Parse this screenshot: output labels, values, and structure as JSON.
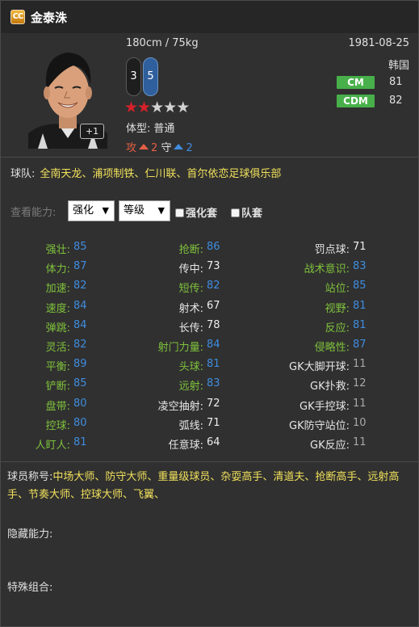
{
  "header": {
    "name": "金泰洙",
    "badge_text": "CC"
  },
  "player": {
    "height_weight": "180cm / 75kg",
    "birthdate": "1981-08-25",
    "nation": "韩国",
    "weak_foot_left": "3",
    "weak_foot_right": "5",
    "stars_total": 5,
    "stars_filled": 2,
    "body_label": "体型:",
    "body_value": "普通",
    "attack_label": "攻",
    "attack_value": "2",
    "defense_label": "守",
    "defense_value": "2",
    "plus_badge": "+1",
    "positions": [
      {
        "name": "CM",
        "rating": "81"
      },
      {
        "name": "CDM",
        "rating": "82"
      }
    ]
  },
  "team": {
    "label": "球队:",
    "value": "全南天龙、浦项制铁、仁川联、首尔依恋足球俱乐部"
  },
  "view": {
    "label": "查看能力:",
    "select1": "强化",
    "select2": "等级",
    "check1": "强化套",
    "check2": "队套"
  },
  "stats": {
    "col1": [
      {
        "label": "强壮:",
        "value": "85"
      },
      {
        "label": "体力:",
        "value": "87"
      },
      {
        "label": "加速:",
        "value": "82"
      },
      {
        "label": "速度:",
        "value": "84"
      },
      {
        "label": "弹跳:",
        "value": "84"
      },
      {
        "label": "灵活:",
        "value": "82"
      },
      {
        "label": "平衡:",
        "value": "89"
      },
      {
        "label": "铲断:",
        "value": "85"
      },
      {
        "label": "盘带:",
        "value": "80"
      },
      {
        "label": "控球:",
        "value": "80"
      },
      {
        "label": "人盯人:",
        "value": "81"
      }
    ],
    "col2": [
      {
        "label": "抢断:",
        "value": "86"
      },
      {
        "label": "传中:",
        "value": "73"
      },
      {
        "label": "短传:",
        "value": "82"
      },
      {
        "label": "射术:",
        "value": "67"
      },
      {
        "label": "长传:",
        "value": "78"
      },
      {
        "label": "射门力量:",
        "value": "84"
      },
      {
        "label": "头球:",
        "value": "81"
      },
      {
        "label": "远射:",
        "value": "83"
      },
      {
        "label": "凌空抽射:",
        "value": "72"
      },
      {
        "label": "弧线:",
        "value": "71"
      },
      {
        "label": "任意球:",
        "value": "64"
      }
    ],
    "col3": [
      {
        "label": "罚点球:",
        "value": "71"
      },
      {
        "label": "战术意识:",
        "value": "83"
      },
      {
        "label": "站位:",
        "value": "85"
      },
      {
        "label": "视野:",
        "value": "81"
      },
      {
        "label": "反应:",
        "value": "81"
      },
      {
        "label": "侵略性:",
        "value": "87"
      },
      {
        "label": "GK大脚开球:",
        "value": "11"
      },
      {
        "label": "GK扑救:",
        "value": "12"
      },
      {
        "label": "GK手控球:",
        "value": "11"
      },
      {
        "label": "GK防守站位:",
        "value": "10"
      },
      {
        "label": "GK反应:",
        "value": "11"
      }
    ]
  },
  "titles": {
    "label": "球员称号:",
    "value": "中场大师、防守大师、重量级球员、杂耍高手、清道夫、抢断高手、远射高手、节奏大师、控球大师、飞翼、"
  },
  "hidden": {
    "label": "隐藏能力:"
  },
  "special": {
    "label": "特殊组合:"
  },
  "colors": {
    "green_label": "#7fc23c",
    "blue_value": "#3f8de0",
    "yellow_text": "#f1e15b",
    "position_badge": "#48b04a",
    "attack_red": "#e35f44"
  }
}
